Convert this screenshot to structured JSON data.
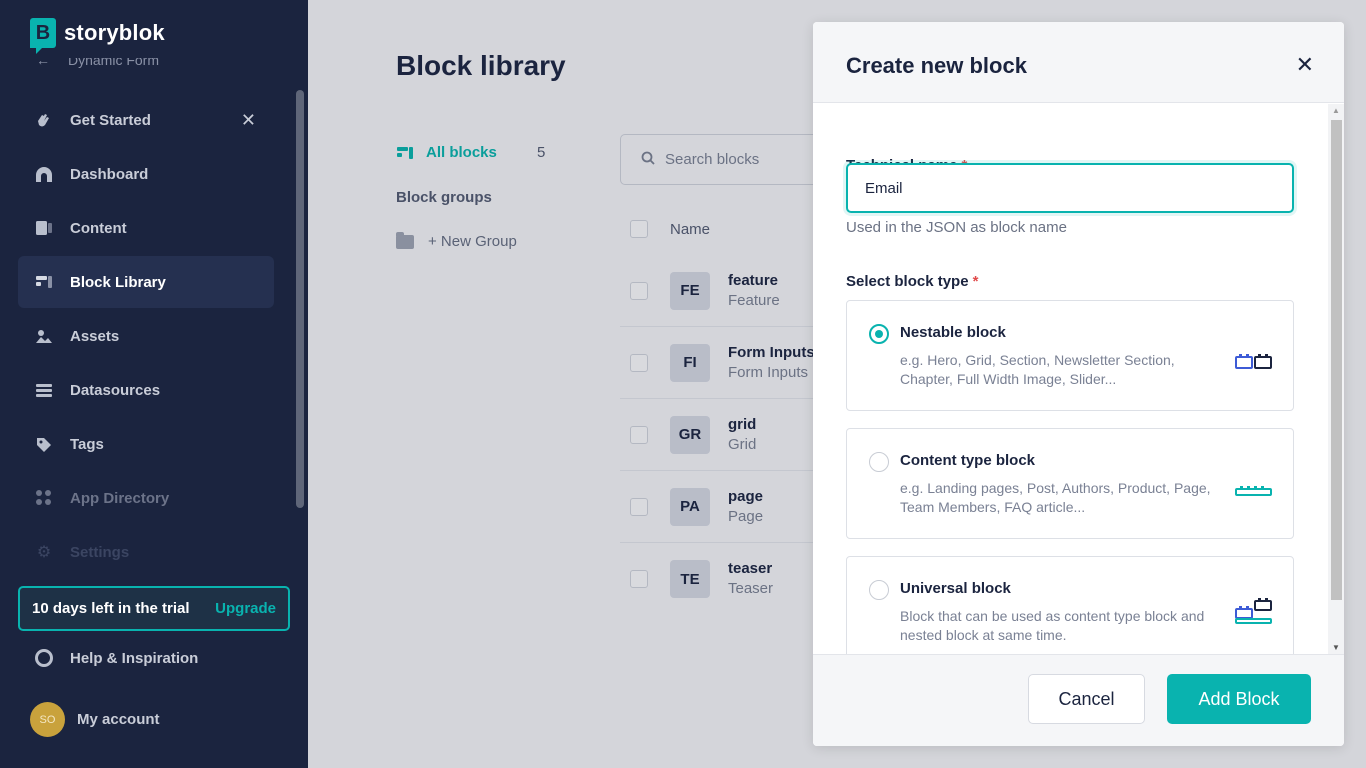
{
  "brand": {
    "name": "storyblok",
    "logo_letter": "B",
    "accent": "#09b3af"
  },
  "sidebar": {
    "back_label": "Dynamic Form",
    "items": [
      {
        "label": "Get Started",
        "icon": "hand-wave-icon",
        "closable": true
      },
      {
        "label": "Dashboard",
        "icon": "dashboard-icon"
      },
      {
        "label": "Content",
        "icon": "content-icon"
      },
      {
        "label": "Block Library",
        "icon": "block-library-icon",
        "active": true
      },
      {
        "label": "Assets",
        "icon": "assets-icon"
      },
      {
        "label": "Datasources",
        "icon": "datasources-icon"
      },
      {
        "label": "Tags",
        "icon": "tag-icon"
      },
      {
        "label": "App Directory",
        "icon": "apps-icon"
      },
      {
        "label": "Settings",
        "icon": "gear-icon"
      }
    ],
    "trial": {
      "text": "10 days left in the trial",
      "upgrade": "Upgrade"
    },
    "help": "Help & Inspiration",
    "account": {
      "initials": "SO",
      "label": "My account"
    }
  },
  "main": {
    "title": "Block library",
    "filters": {
      "all_label": "All blocks",
      "all_count": "5",
      "groups_title": "Block groups",
      "new_group": "+ New Group"
    },
    "search_placeholder": "Search blocks",
    "column_name": "Name",
    "rows": [
      {
        "badge": "FE",
        "name": "feature",
        "sub": "Feature"
      },
      {
        "badge": "FI",
        "name": "Form Inputs",
        "sub": "Form Inputs"
      },
      {
        "badge": "GR",
        "name": "grid",
        "sub": "Grid"
      },
      {
        "badge": "PA",
        "name": "page",
        "sub": "Page"
      },
      {
        "badge": "TE",
        "name": "teaser",
        "sub": "Teaser"
      }
    ]
  },
  "modal": {
    "title": "Create new block",
    "technical_name_label": "Technical name",
    "required_mark": "*",
    "technical_name_value": "Email",
    "technical_name_hint": "Used in the JSON as block name",
    "block_type_label": "Select block type",
    "types": [
      {
        "title": "Nestable block",
        "desc": "e.g. Hero, Grid, Section, Newsletter Section, Chapter, Full Width Image, Slider...",
        "selected": true,
        "icon": "nestable-block-icon"
      },
      {
        "title": "Content type block",
        "desc": "e.g. Landing pages, Post, Authors, Product, Page, Team Members, FAQ article...",
        "selected": false,
        "icon": "content-type-block-icon"
      },
      {
        "title": "Universal block",
        "desc": "Block that can be used as content type block and nested block at same time.",
        "selected": false,
        "icon": "universal-block-icon"
      }
    ],
    "cancel_label": "Cancel",
    "add_label": "Add Block"
  }
}
